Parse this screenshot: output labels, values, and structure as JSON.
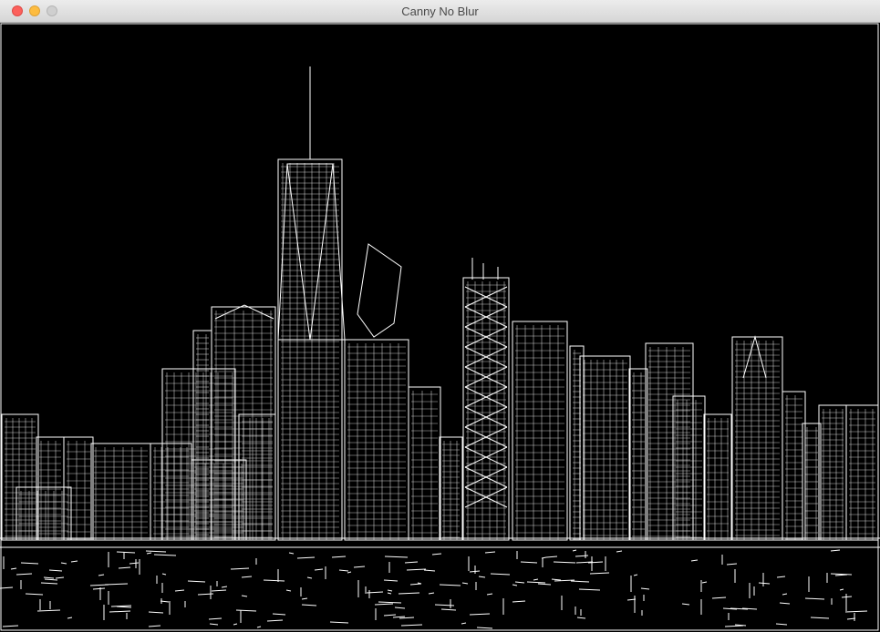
{
  "window": {
    "title": "Canny No Blur",
    "controls": [
      "close",
      "minimize",
      "maximize"
    ],
    "traffic_colors": {
      "close": "#fc605c",
      "minimize": "#fdbc40",
      "maximize": "#cfcfcf"
    }
  },
  "image": {
    "description_icon": "edge-detected-skyline-image",
    "background": "#000000",
    "edge_color": "#ffffff"
  }
}
